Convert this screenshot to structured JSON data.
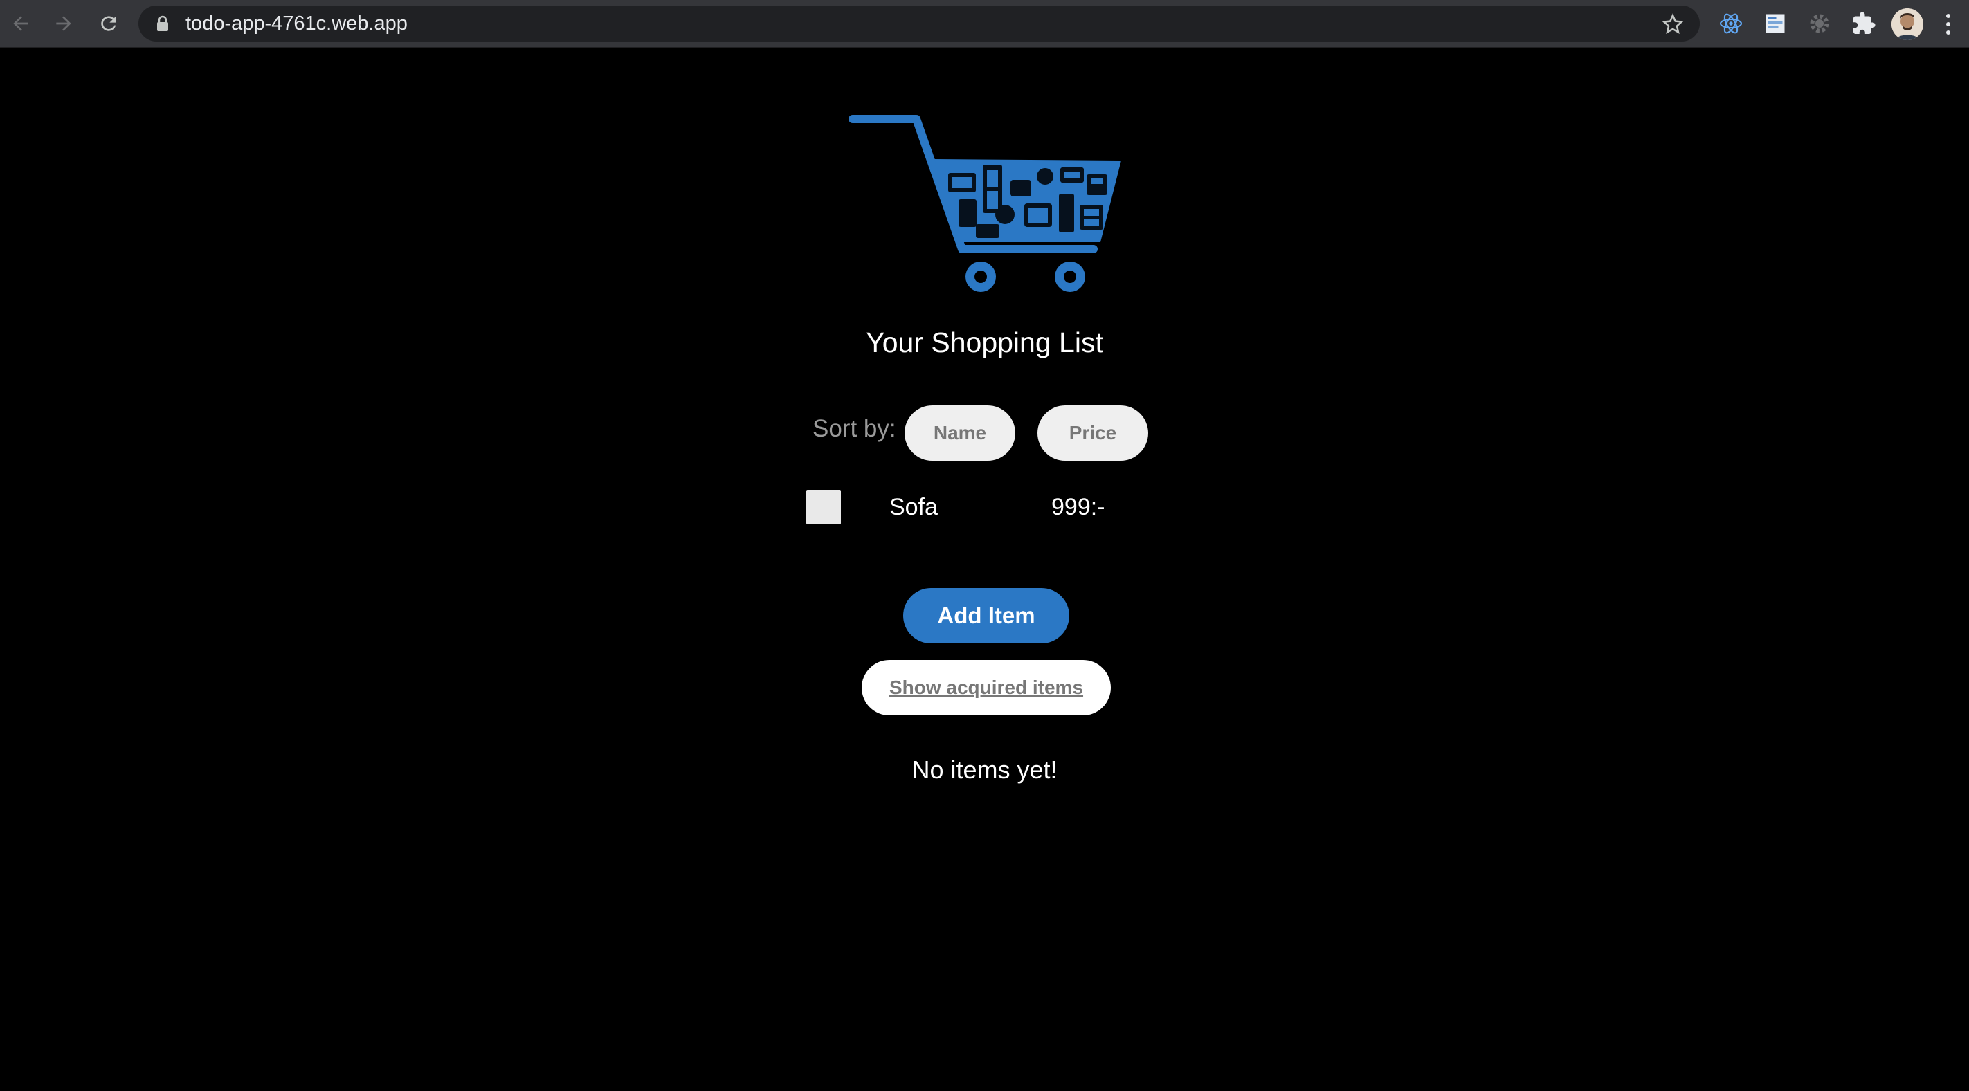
{
  "browser": {
    "url": "todo-app-4761c.web.app"
  },
  "app": {
    "title": "Your Shopping List",
    "sort_label": "Sort by:",
    "sort_options": [
      "Name",
      "Price"
    ],
    "items": [
      {
        "name": "Sofa",
        "price": "999:-",
        "acquired": false
      }
    ],
    "add_button": "Add Item",
    "show_acquired_button": "Show acquired items",
    "empty_message": "No items yet!",
    "colors": {
      "accent": "#2b78c5",
      "background": "#000000"
    }
  }
}
